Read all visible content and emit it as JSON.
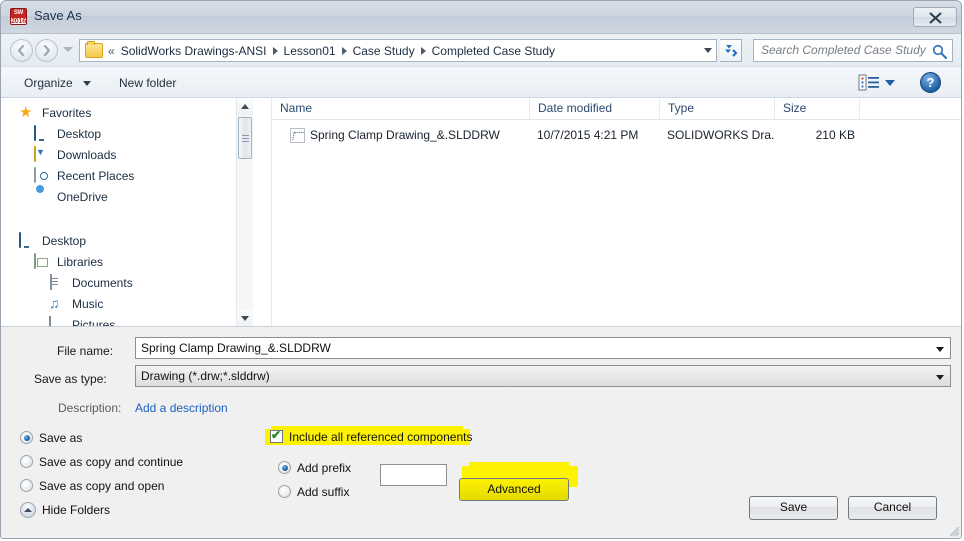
{
  "window": {
    "title": "Save As",
    "app_icon": "solidworks-2016-icon",
    "app_icon_top": "SW",
    "app_icon_year": "2016",
    "close_label": "Close"
  },
  "navbar": {
    "back_icon": "back-arrow-icon",
    "forward_icon": "forward-arrow-icon",
    "recent_pages_icon": "chevron-down-icon",
    "overflow": "«",
    "breadcrumbs": [
      "SolidWorks Drawings-ANSI",
      "Lesson01",
      "Case Study",
      "Completed Case Study"
    ],
    "refresh_icon": "refresh-icon",
    "search_placeholder": "Search Completed Case Study",
    "search_value": "",
    "search_icon": "search-icon"
  },
  "toolbar": {
    "organize": "Organize",
    "new_folder": "New folder",
    "views_icon": "view-list-icon",
    "help_icon": "help-icon",
    "help_glyph": "?"
  },
  "navpane": {
    "items": [
      {
        "label": "Favorites",
        "icon": "star-icon",
        "indent": 0
      },
      {
        "label": "Desktop",
        "icon": "monitor-icon",
        "indent": 1
      },
      {
        "label": "Downloads",
        "icon": "download-icon",
        "indent": 1
      },
      {
        "label": "Recent Places",
        "icon": "recent-icon",
        "indent": 1
      },
      {
        "label": "OneDrive",
        "icon": "cloud-icon",
        "indent": 1
      },
      {
        "label": "Desktop",
        "icon": "monitor-icon",
        "indent": 0
      },
      {
        "label": "Libraries",
        "icon": "library-icon",
        "indent": 1
      },
      {
        "label": "Documents",
        "icon": "document-icon",
        "indent": 2
      },
      {
        "label": "Music",
        "icon": "music-icon",
        "indent": 2
      },
      {
        "label": "Pictures",
        "icon": "picture-icon",
        "indent": 2
      }
    ],
    "scrollbar": {
      "up_icon": "scroll-up-icon",
      "down_icon": "scroll-down-icon"
    }
  },
  "filelist": {
    "columns": [
      "Name",
      "Date modified",
      "Type",
      "Size"
    ],
    "sort_column": "Name",
    "rows": [
      {
        "name": "Spring Clamp Drawing_&.SLDDRW",
        "date_modified": "10/7/2015 4:21 PM",
        "type": "SOLIDWORKS Dra...",
        "size": "210 KB",
        "icon": "slddrw-file-icon"
      }
    ]
  },
  "form": {
    "file_name_label": "File name:",
    "file_name_value": "Spring Clamp Drawing_&.SLDDRW",
    "save_as_type_label": "Save as type:",
    "save_as_type_value": "Drawing (*.drw;*.slddrw)",
    "description_label": "Description:",
    "description_link": "Add a description"
  },
  "save_options": {
    "radios": [
      {
        "label": "Save as",
        "selected": true
      },
      {
        "label": "Save as copy and continue",
        "selected": false
      },
      {
        "label": "Save as copy and open",
        "selected": false
      }
    ],
    "hide_folders": "Hide Folders",
    "include_refs": {
      "label": "Include all referenced components",
      "checked": true,
      "highlighted": true
    },
    "affix_radios": [
      {
        "label": "Add prefix",
        "selected": true
      },
      {
        "label": "Add suffix",
        "selected": false
      }
    ],
    "affix_value": "",
    "advanced_label": "Advanced",
    "advanced_highlighted": true
  },
  "actions": {
    "save": "Save",
    "cancel": "Cancel"
  },
  "colors": {
    "highlight": "#fdf202",
    "link": "#1b62c0",
    "accent": "#1f5fa8"
  }
}
